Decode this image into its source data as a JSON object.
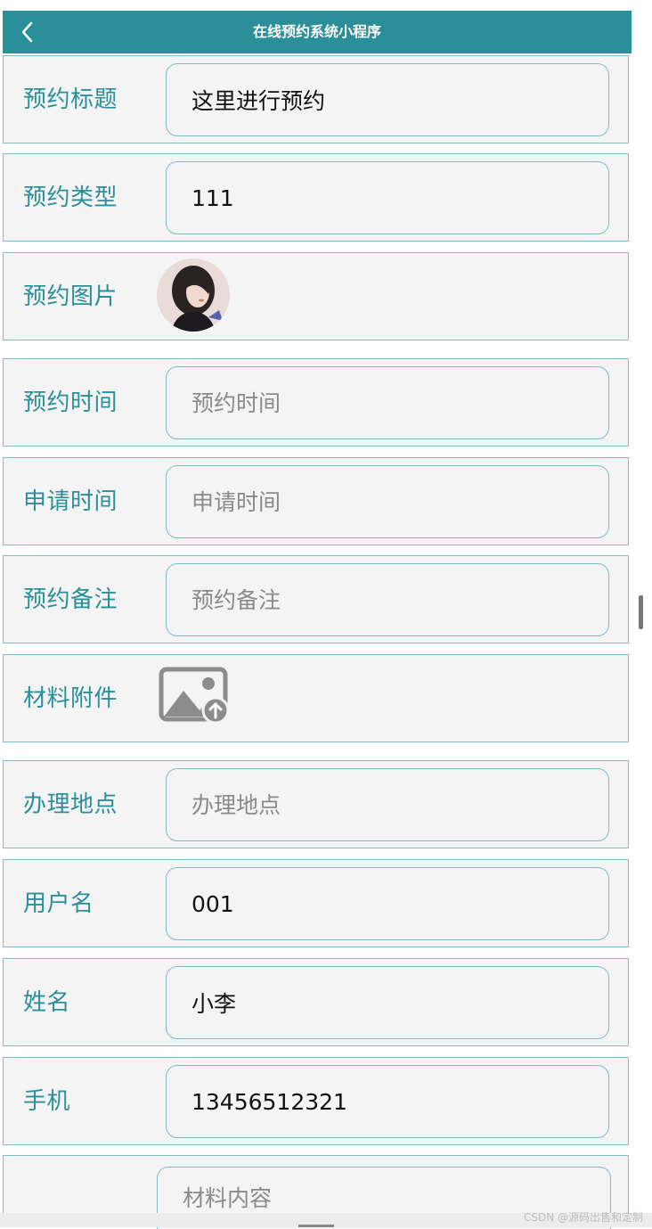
{
  "header": {
    "title": "在线预约系统小程序",
    "back_icon": "chevron-left-icon"
  },
  "form": {
    "title_label": "预约标题",
    "title_value": "这里进行预约",
    "type_label": "预约类型",
    "type_value": "111",
    "image_label": "预约图片",
    "time_label": "预约时间",
    "time_placeholder": "预约时间",
    "apply_time_label": "申请时间",
    "apply_time_placeholder": "申请时间",
    "remark_label": "预约备注",
    "remark_placeholder": "预约备注",
    "attachment_label": "材料附件",
    "location_label": "办理地点",
    "location_placeholder": "办理地点",
    "username_label": "用户名",
    "username_value": "001",
    "name_label": "姓名",
    "name_value": "小李",
    "phone_label": "手机",
    "phone_value": "13456512321",
    "material_placeholder": "材料内容"
  },
  "footer": {
    "watermark": "CSDN @源码出售和定制"
  },
  "colors": {
    "accent": "#2b8f99",
    "border": "#7fbcc5",
    "row_bg": "#f4f4f4"
  }
}
